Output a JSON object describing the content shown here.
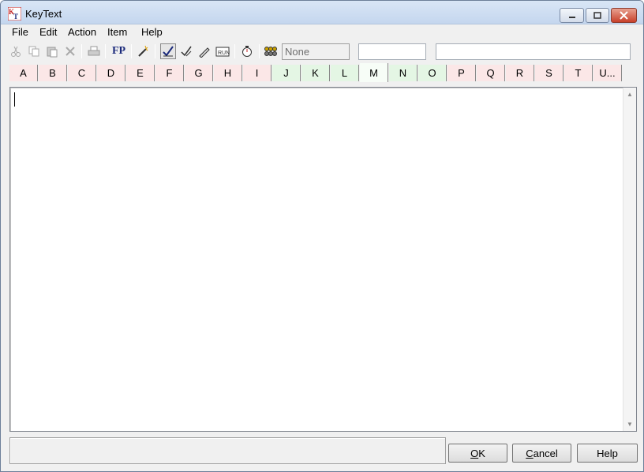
{
  "window": {
    "title": "KeyText"
  },
  "menu": [
    {
      "label": "File"
    },
    {
      "label": "Edit"
    },
    {
      "label": "Action"
    },
    {
      "label": "Item"
    },
    {
      "label": "Help"
    }
  ],
  "toolbar": {
    "fp_label": "FP",
    "dropdown_value": "None",
    "field1_value": "",
    "field2_value": ""
  },
  "tabs": [
    "A",
    "B",
    "C",
    "D",
    "E",
    "F",
    "G",
    "H",
    "I",
    "J",
    "K",
    "L",
    "M",
    "N",
    "O",
    "P",
    "Q",
    "R",
    "S",
    "T",
    "U..."
  ],
  "editor": {
    "content": ""
  },
  "status": {
    "text": ""
  },
  "buttons": {
    "ok": {
      "label": "OK",
      "accel": "O",
      "rest": "K"
    },
    "cancel": {
      "label": "Cancel",
      "accel": "C",
      "rest": "ancel"
    },
    "help": {
      "label": "Help"
    }
  },
  "colors": {
    "tab_red": "#fbe7e7",
    "tab_green": "#e4f6e4",
    "title_gradient_top": "#d9e6f6"
  }
}
